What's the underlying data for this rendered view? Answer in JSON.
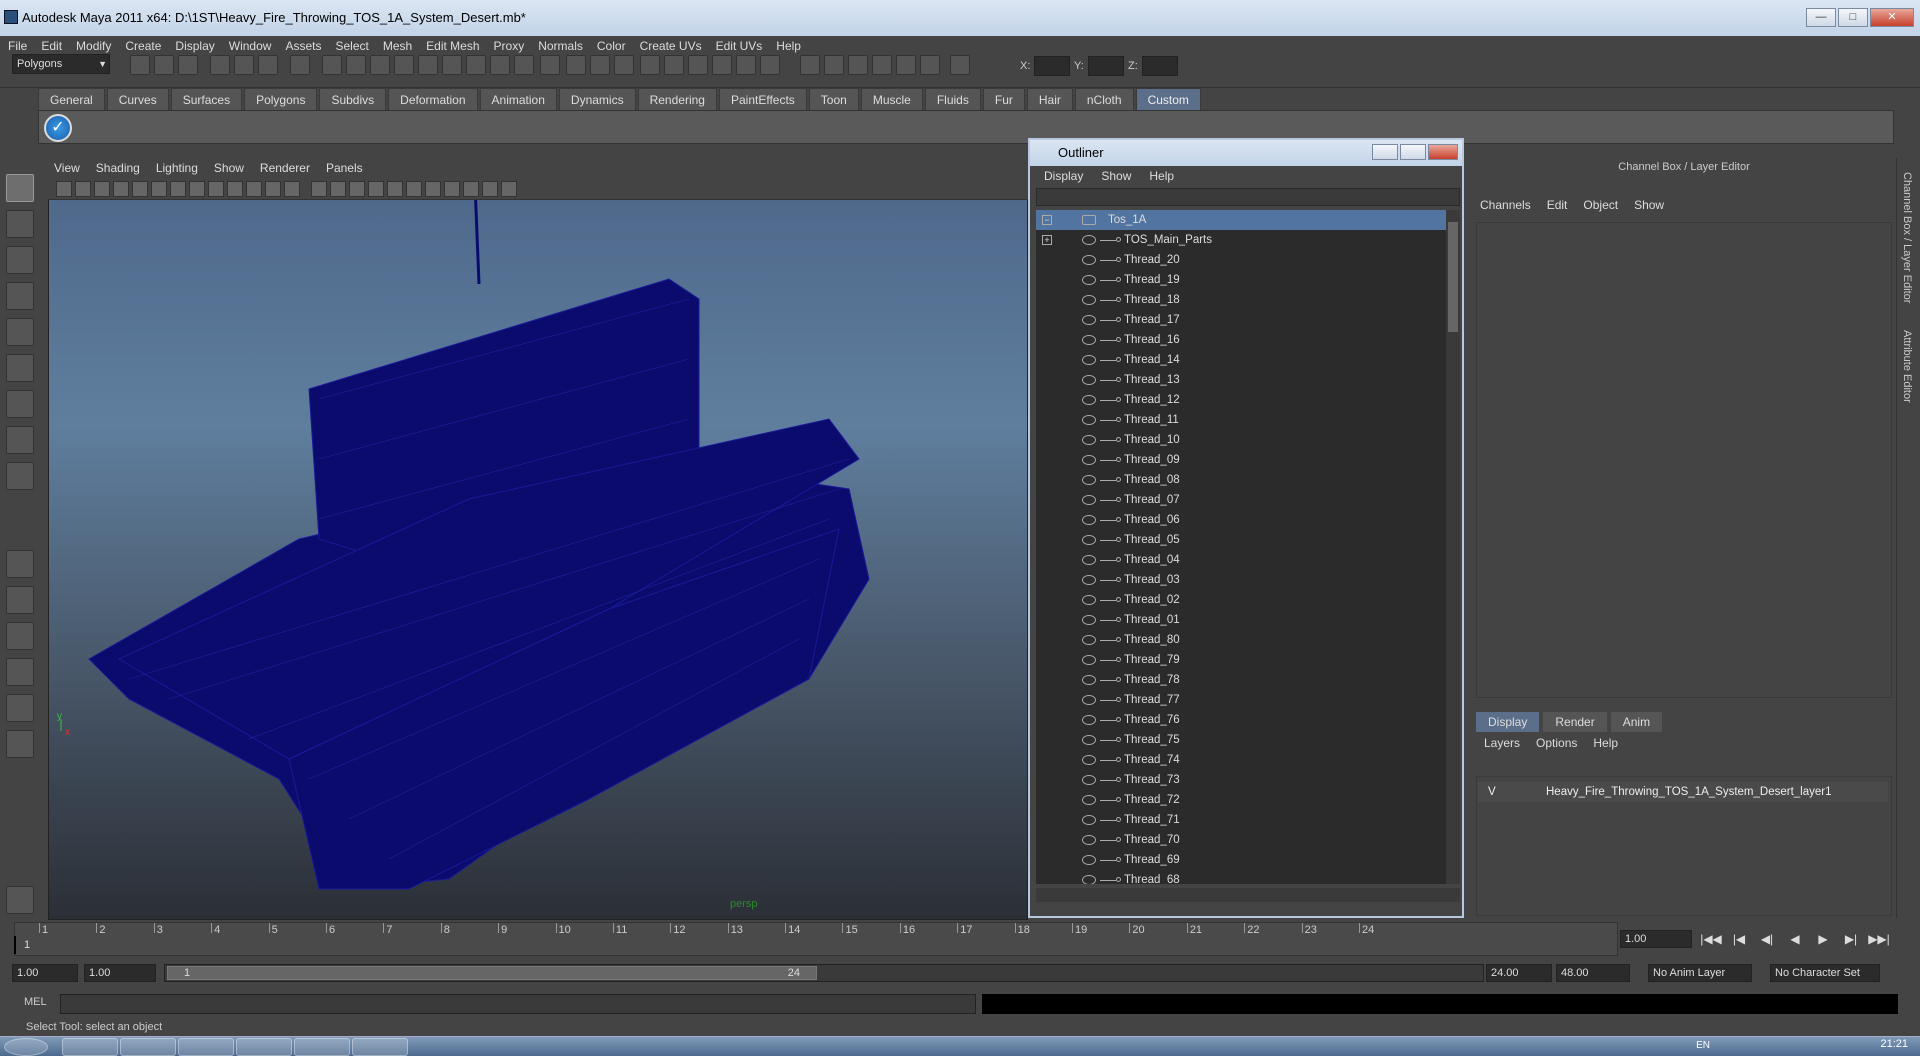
{
  "window": {
    "title": "Autodesk Maya 2011 x64: D:\\1ST\\Heavy_Fire_Throwing_TOS_1A_System_Desert.mb*",
    "minimize": "—",
    "maximize": "□",
    "close": "✕"
  },
  "menubar": [
    "File",
    "Edit",
    "Modify",
    "Create",
    "Display",
    "Window",
    "Assets",
    "Select",
    "Mesh",
    "Edit Mesh",
    "Proxy",
    "Normals",
    "Color",
    "Create UVs",
    "Edit UVs",
    "Help"
  ],
  "statusline": {
    "mode": "Polygons",
    "x_label": "X:",
    "y_label": "Y:",
    "z_label": "Z:"
  },
  "shelf_tabs": [
    "General",
    "Curves",
    "Surfaces",
    "Polygons",
    "Subdivs",
    "Deformation",
    "Animation",
    "Dynamics",
    "Rendering",
    "PaintEffects",
    "Toon",
    "Muscle",
    "Fluids",
    "Fur",
    "Hair",
    "nCloth",
    "Custom"
  ],
  "shelf_active": "Custom",
  "viewport": {
    "menu": [
      "View",
      "Shading",
      "Lighting",
      "Show",
      "Renderer",
      "Panels"
    ],
    "camera": "persp",
    "axis_y": "y",
    "axis_x": "x"
  },
  "outliner": {
    "title": "Outliner",
    "menu": [
      "Display",
      "Show",
      "Help"
    ],
    "items": [
      {
        "label": "Tos_1A",
        "selected": true,
        "root": true
      },
      {
        "label": "TOS_Main_Parts",
        "expand": true
      },
      {
        "label": "Thread_20"
      },
      {
        "label": "Thread_19"
      },
      {
        "label": "Thread_18"
      },
      {
        "label": "Thread_17"
      },
      {
        "label": "Thread_16"
      },
      {
        "label": "Thread_14"
      },
      {
        "label": "Thread_13"
      },
      {
        "label": "Thread_12"
      },
      {
        "label": "Thread_11"
      },
      {
        "label": "Thread_10"
      },
      {
        "label": "Thread_09"
      },
      {
        "label": "Thread_08"
      },
      {
        "label": "Thread_07"
      },
      {
        "label": "Thread_06"
      },
      {
        "label": "Thread_05"
      },
      {
        "label": "Thread_04"
      },
      {
        "label": "Thread_03"
      },
      {
        "label": "Thread_02"
      },
      {
        "label": "Thread_01"
      },
      {
        "label": "Thread_80"
      },
      {
        "label": "Thread_79"
      },
      {
        "label": "Thread_78"
      },
      {
        "label": "Thread_77"
      },
      {
        "label": "Thread_76"
      },
      {
        "label": "Thread_75"
      },
      {
        "label": "Thread_74"
      },
      {
        "label": "Thread_73"
      },
      {
        "label": "Thread_72"
      },
      {
        "label": "Thread_71"
      },
      {
        "label": "Thread_70"
      },
      {
        "label": "Thread_69"
      },
      {
        "label": "Thread_68"
      }
    ]
  },
  "channel_box": {
    "title": "Channel Box / Layer Editor",
    "menu": [
      "Channels",
      "Edit",
      "Object",
      "Show"
    ],
    "layer_tabs": [
      "Display",
      "Render",
      "Anim"
    ],
    "layer_active": "Display",
    "layer_menu": [
      "Layers",
      "Options",
      "Help"
    ],
    "layer": {
      "visible": "V",
      "name": "Heavy_Fire_Throwing_TOS_1A_System_Desert_layer1"
    },
    "side_tabs": [
      "Channel Box / Layer Editor",
      "Attribute Editor"
    ]
  },
  "timeline": {
    "ticks": [
      "1",
      "2",
      "3",
      "4",
      "5",
      "6",
      "7",
      "8",
      "9",
      "10",
      "11",
      "12",
      "13",
      "14",
      "15",
      "16",
      "17",
      "18",
      "19",
      "20",
      "21",
      "22",
      "23",
      "24"
    ],
    "current_frame": "1",
    "current_time": "1.00"
  },
  "playback": {
    "buttons": [
      "|◀◀",
      "|◀",
      "◀|",
      "◀",
      "▶",
      "▶|",
      "▶▶|"
    ]
  },
  "range": {
    "start": "1.00",
    "inner_start": "1.00",
    "slider_start": "1",
    "slider_end": "24",
    "end": "24.00",
    "outer_end": "48.00",
    "anim_layer": "No Anim Layer",
    "char_set": "No Character Set"
  },
  "mel": {
    "label": "MEL"
  },
  "help_line": "Select Tool: select an object",
  "taskbar": {
    "lang": "EN",
    "clock": "21:21"
  }
}
